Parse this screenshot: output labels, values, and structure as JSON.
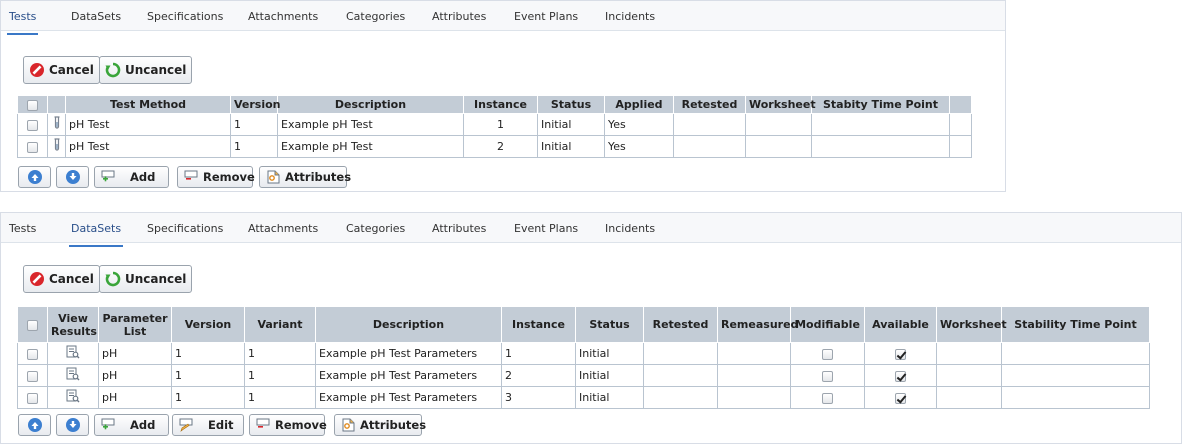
{
  "panel1": {
    "tabs": [
      "Tests",
      "DataSets",
      "Specifications",
      "Attachments",
      "Categories",
      "Attributes",
      "Event Plans",
      "Incidents"
    ],
    "active_tab": "Tests",
    "cancel_label": "Cancel",
    "uncancel_label": "Uncancel",
    "columns": [
      "Test Method",
      "Version",
      "Description",
      "Instance",
      "Status",
      "Applied",
      "Retested",
      "Worksheet",
      "Stabity Time Point"
    ],
    "rows": [
      {
        "test_method": "pH Test",
        "version": "1",
        "description": "Example pH Test",
        "instance": "1",
        "status": "Initial",
        "applied": "Yes",
        "retested": "",
        "worksheet": "",
        "stability": ""
      },
      {
        "test_method": "pH Test",
        "version": "1",
        "description": "Example pH Test",
        "instance": "2",
        "status": "Initial",
        "applied": "Yes",
        "retested": "",
        "worksheet": "",
        "stability": ""
      }
    ],
    "footer": {
      "add": "Add",
      "remove": "Remove",
      "attributes": "Attributes"
    }
  },
  "panel2": {
    "tabs": [
      "Tests",
      "DataSets",
      "Specifications",
      "Attachments",
      "Categories",
      "Attributes",
      "Event Plans",
      "Incidents"
    ],
    "active_tab": "DataSets",
    "cancel_label": "Cancel",
    "uncancel_label": "Uncancel",
    "columns": {
      "view_results_1": "View",
      "view_results_2": "Results",
      "param_list_1": "Parameter",
      "param_list_2": "List",
      "version": "Version",
      "variant": "Variant",
      "description": "Description",
      "instance": "Instance",
      "status": "Status",
      "retested": "Retested",
      "remeasured": "Remeasured",
      "modifiable": "Modifiable",
      "available": "Available",
      "worksheet": "Worksheet",
      "stability": "Stability Time Point"
    },
    "rows": [
      {
        "param_list": "pH",
        "version": "1",
        "variant": "1",
        "description": "Example pH Test Parameters",
        "instance": "1",
        "status": "Initial",
        "modifiable": false,
        "available": true
      },
      {
        "param_list": "pH",
        "version": "1",
        "variant": "1",
        "description": "Example pH Test Parameters",
        "instance": "2",
        "status": "Initial",
        "modifiable": false,
        "available": true
      },
      {
        "param_list": "pH",
        "version": "1",
        "variant": "1",
        "description": "Example pH Test Parameters",
        "instance": "3",
        "status": "Initial",
        "modifiable": false,
        "available": true
      }
    ],
    "footer": {
      "add": "Add",
      "edit": "Edit",
      "remove": "Remove",
      "attributes": "Attributes"
    }
  },
  "colors": {
    "header_bg": "#c3ccd6",
    "link": "#3b58a8",
    "tab_underline": "#3a78c7",
    "cancel_red": "#d9262b",
    "uncancel_green": "#3aa53a",
    "nav_blue": "#3c7fd0"
  },
  "icons": [
    "cancel-icon",
    "uncancel-icon",
    "test-tube-icon",
    "view-results-icon",
    "move-up-icon",
    "move-down-icon",
    "add-icon",
    "edit-icon",
    "remove-icon",
    "attributes-icon"
  ]
}
